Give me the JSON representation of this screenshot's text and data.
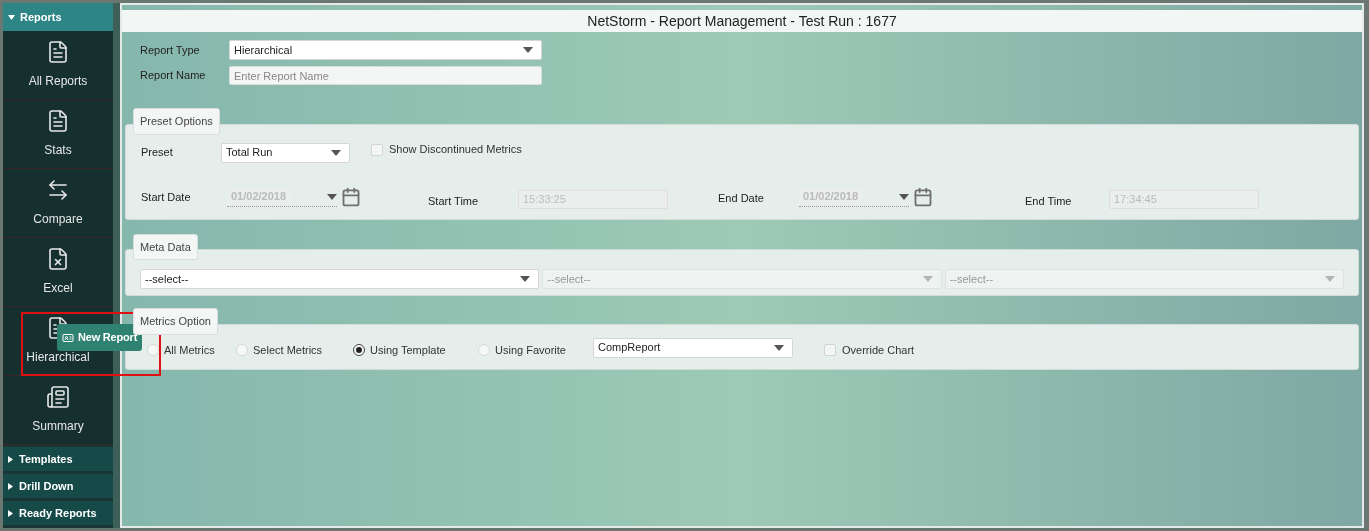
{
  "sidebar": {
    "header": {
      "label": "Reports",
      "expanded": true
    },
    "items": [
      {
        "label": "All Reports"
      },
      {
        "label": "Stats"
      },
      {
        "label": "Compare"
      },
      {
        "label": "Excel"
      },
      {
        "label": "Hierarchical"
      },
      {
        "label": "Summary"
      }
    ],
    "sections": [
      {
        "label": "Templates",
        "expanded": false
      },
      {
        "label": "Drill Down",
        "expanded": false
      },
      {
        "label": "Ready Reports",
        "expanded": false
      }
    ]
  },
  "tooltip": {
    "label": "New Report"
  },
  "title": "NetStorm - Report Management - Test Run : 1677",
  "report_type": {
    "label": "Report Type",
    "value": "Hierarchical"
  },
  "report_name": {
    "label": "Report Name",
    "placeholder": "Enter Report Name"
  },
  "preset_options": {
    "legend": "Preset Options",
    "preset": {
      "label": "Preset",
      "value": "Total Run"
    },
    "show_discontinued": {
      "label": "Show Discontinued Metrics",
      "checked": false
    },
    "start_date": {
      "label": "Start Date",
      "value": "01/02/2018",
      "disabled": true
    },
    "start_time": {
      "label": "Start Time",
      "value": "15:33:25",
      "disabled": true
    },
    "end_date": {
      "label": "End Date",
      "value": "01/02/2018",
      "disabled": true
    },
    "end_time": {
      "label": "End Time",
      "value": "17:34:45",
      "disabled": true
    }
  },
  "meta_data": {
    "legend": "Meta Data",
    "selects": [
      {
        "value": "--select--",
        "disabled": false
      },
      {
        "value": "--select--",
        "disabled": true
      },
      {
        "value": "--select--",
        "disabled": true
      }
    ]
  },
  "metrics_option": {
    "legend": "Metrics Option",
    "options": [
      {
        "label": "All Metrics",
        "selected": false
      },
      {
        "label": "Select Metrics",
        "selected": false
      },
      {
        "label": "Using Template",
        "selected": true
      },
      {
        "label": "Using Favorite",
        "selected": false
      }
    ],
    "template": {
      "value": "CompReport"
    },
    "override_chart": {
      "label": "Override Chart",
      "checked": false
    }
  }
}
